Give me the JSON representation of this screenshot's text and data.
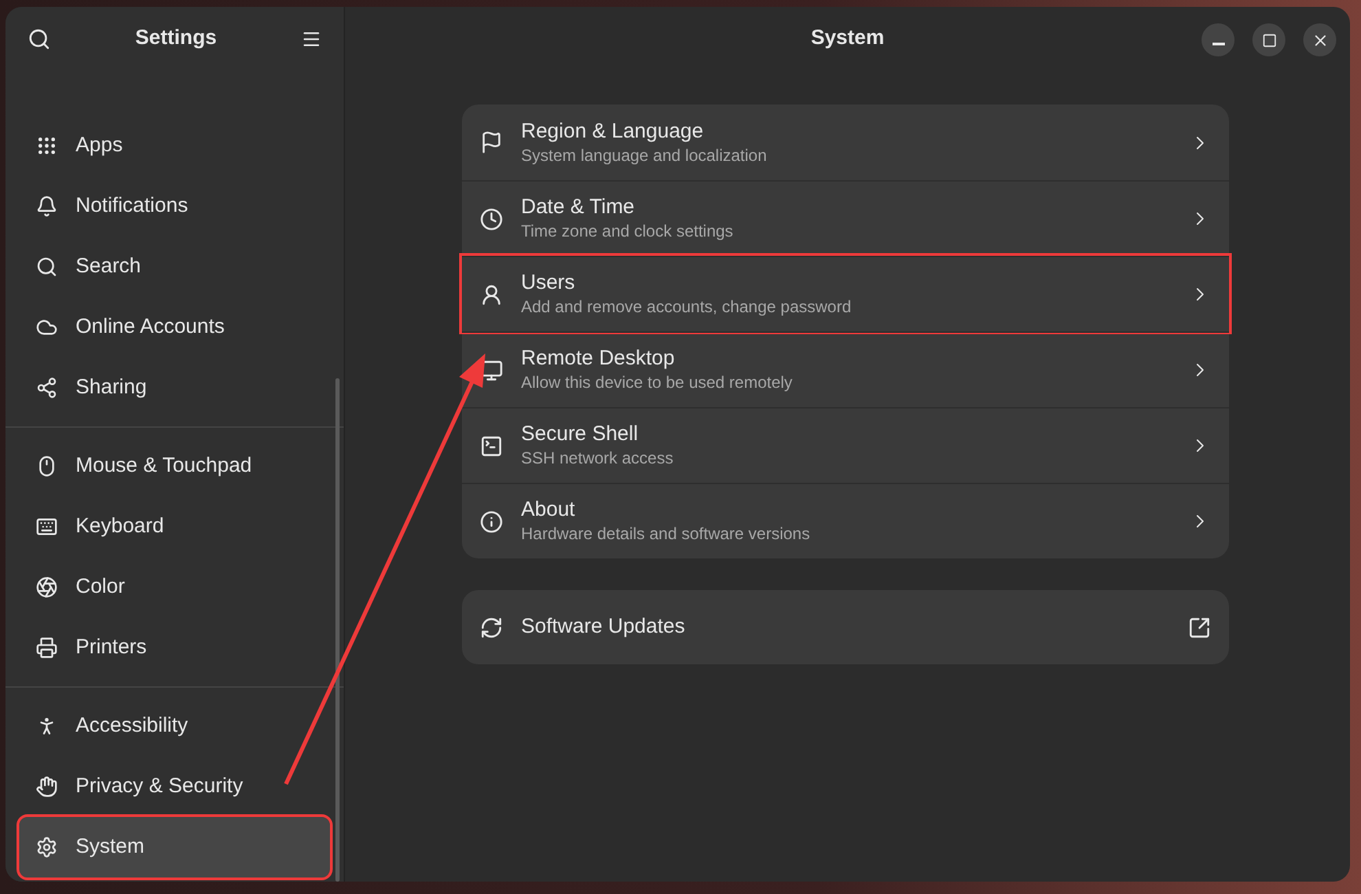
{
  "sidebar": {
    "title": "Settings",
    "groups": [
      [
        {
          "label": "Apps",
          "selected": false,
          "annotated": false
        },
        {
          "label": "Notifications",
          "selected": false,
          "annotated": false
        },
        {
          "label": "Search",
          "selected": false,
          "annotated": false
        },
        {
          "label": "Online Accounts",
          "selected": false,
          "annotated": false
        },
        {
          "label": "Sharing",
          "selected": false,
          "annotated": false
        }
      ],
      [
        {
          "label": "Mouse & Touchpad",
          "selected": false,
          "annotated": false
        },
        {
          "label": "Keyboard",
          "selected": false,
          "annotated": false
        },
        {
          "label": "Color",
          "selected": false,
          "annotated": false
        },
        {
          "label": "Printers",
          "selected": false,
          "annotated": false
        }
      ],
      [
        {
          "label": "Accessibility",
          "selected": false,
          "annotated": false
        },
        {
          "label": "Privacy & Security",
          "selected": false,
          "annotated": false
        },
        {
          "label": "System",
          "selected": true,
          "annotated": true
        }
      ]
    ]
  },
  "main": {
    "title": "System",
    "rows": [
      {
        "title": "Region & Language",
        "subtitle": "System language and localization",
        "annotated": false
      },
      {
        "title": "Date & Time",
        "subtitle": "Time zone and clock settings",
        "annotated": false
      },
      {
        "title": "Users",
        "subtitle": "Add and remove accounts, change password",
        "annotated": true
      },
      {
        "title": "Remote Desktop",
        "subtitle": "Allow this device to be used remotely",
        "annotated": false
      },
      {
        "title": "Secure Shell",
        "subtitle": "SSH network access",
        "annotated": false
      },
      {
        "title": "About",
        "subtitle": "Hardware details and software versions",
        "annotated": false
      }
    ],
    "updates": {
      "title": "Software Updates"
    }
  }
}
